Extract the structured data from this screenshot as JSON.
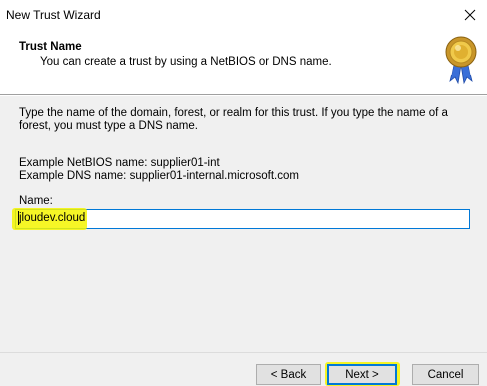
{
  "window": {
    "title": "New Trust Wizard"
  },
  "header": {
    "title": "Trust Name",
    "subtitle": "You can create a trust by using a NetBIOS or DNS name."
  },
  "main": {
    "description": "Type the name of the domain, forest, or realm for this trust. If you type the name of a forest, you must type a DNS name.",
    "example_netbios": "Example NetBIOS name: supplier01-int",
    "example_dns": "Example DNS name: supplier01-internal.microsoft.com",
    "name_label": "Name:",
    "name_value": "jloudev.cloud"
  },
  "buttons": {
    "back": "< Back",
    "next": "Next >",
    "cancel": "Cancel"
  },
  "colors": {
    "highlight": "#f4f400",
    "focus_border": "#0078d7"
  }
}
